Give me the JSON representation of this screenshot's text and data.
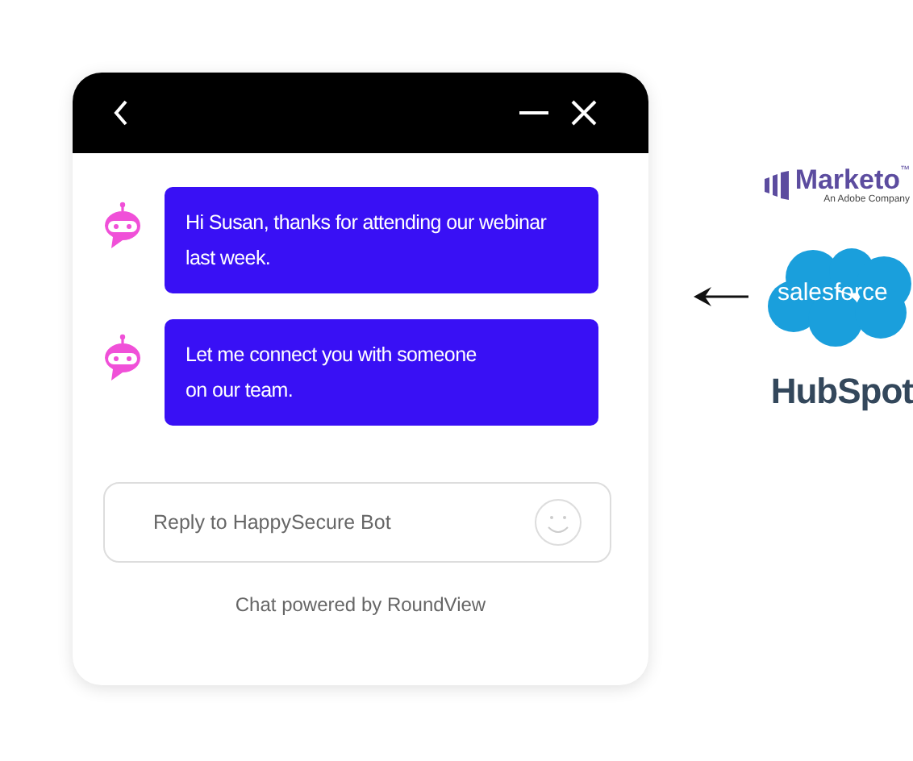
{
  "chat_window": {
    "messages": [
      {
        "text": "Hi Susan, thanks for attending our webinar\nlast week."
      },
      {
        "text": "Let me connect you with someone\non our team."
      }
    ],
    "reply_field": {
      "placeholder": "Reply to HappySecure Bot"
    },
    "footer": "Chat powered by RoundView"
  },
  "integrations": {
    "marketo": {
      "name": "Marketo",
      "trademark": "™",
      "tagline": "An Adobe Company"
    },
    "salesforce": {
      "name": "salesforce"
    },
    "hubspot": {
      "name": "HubSpot"
    }
  }
}
